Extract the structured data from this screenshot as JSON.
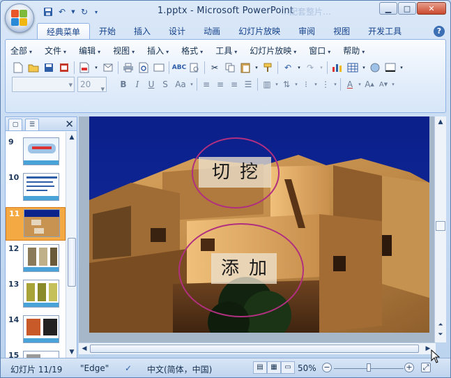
{
  "window": {
    "title": "1.pptx - Microsoft PowerPoint",
    "ghost_title": "…配套整片…"
  },
  "ribbon": {
    "tabs": [
      "经典菜单",
      "开始",
      "插入",
      "设计",
      "动画",
      "幻灯片放映",
      "审阅",
      "视图",
      "开发工具"
    ],
    "menubar": [
      "全部",
      "文件",
      "编辑",
      "视图",
      "插入",
      "格式",
      "工具",
      "幻灯片放映",
      "窗口",
      "帮助"
    ],
    "font_name": "",
    "font_size": "20"
  },
  "slide_panel": {
    "thumbnails": [
      {
        "number": "9"
      },
      {
        "number": "10"
      },
      {
        "number": "11"
      },
      {
        "number": "12"
      },
      {
        "number": "13"
      },
      {
        "number": "14"
      },
      {
        "number": "15"
      }
    ],
    "selected": "11"
  },
  "slide": {
    "label_top": "切挖",
    "label_bottom": "添加"
  },
  "status": {
    "slide_info": "幻灯片 11/19",
    "theme": "\"Edge\"",
    "language": "中文(简体，中国)",
    "zoom": "50%",
    "zoom_fraction": 0.5
  },
  "colors": {
    "ribbon_text": "#15428b",
    "selection": "#f5a943",
    "ellipse": "#b0307f",
    "slide_sky": "#0c238c"
  }
}
